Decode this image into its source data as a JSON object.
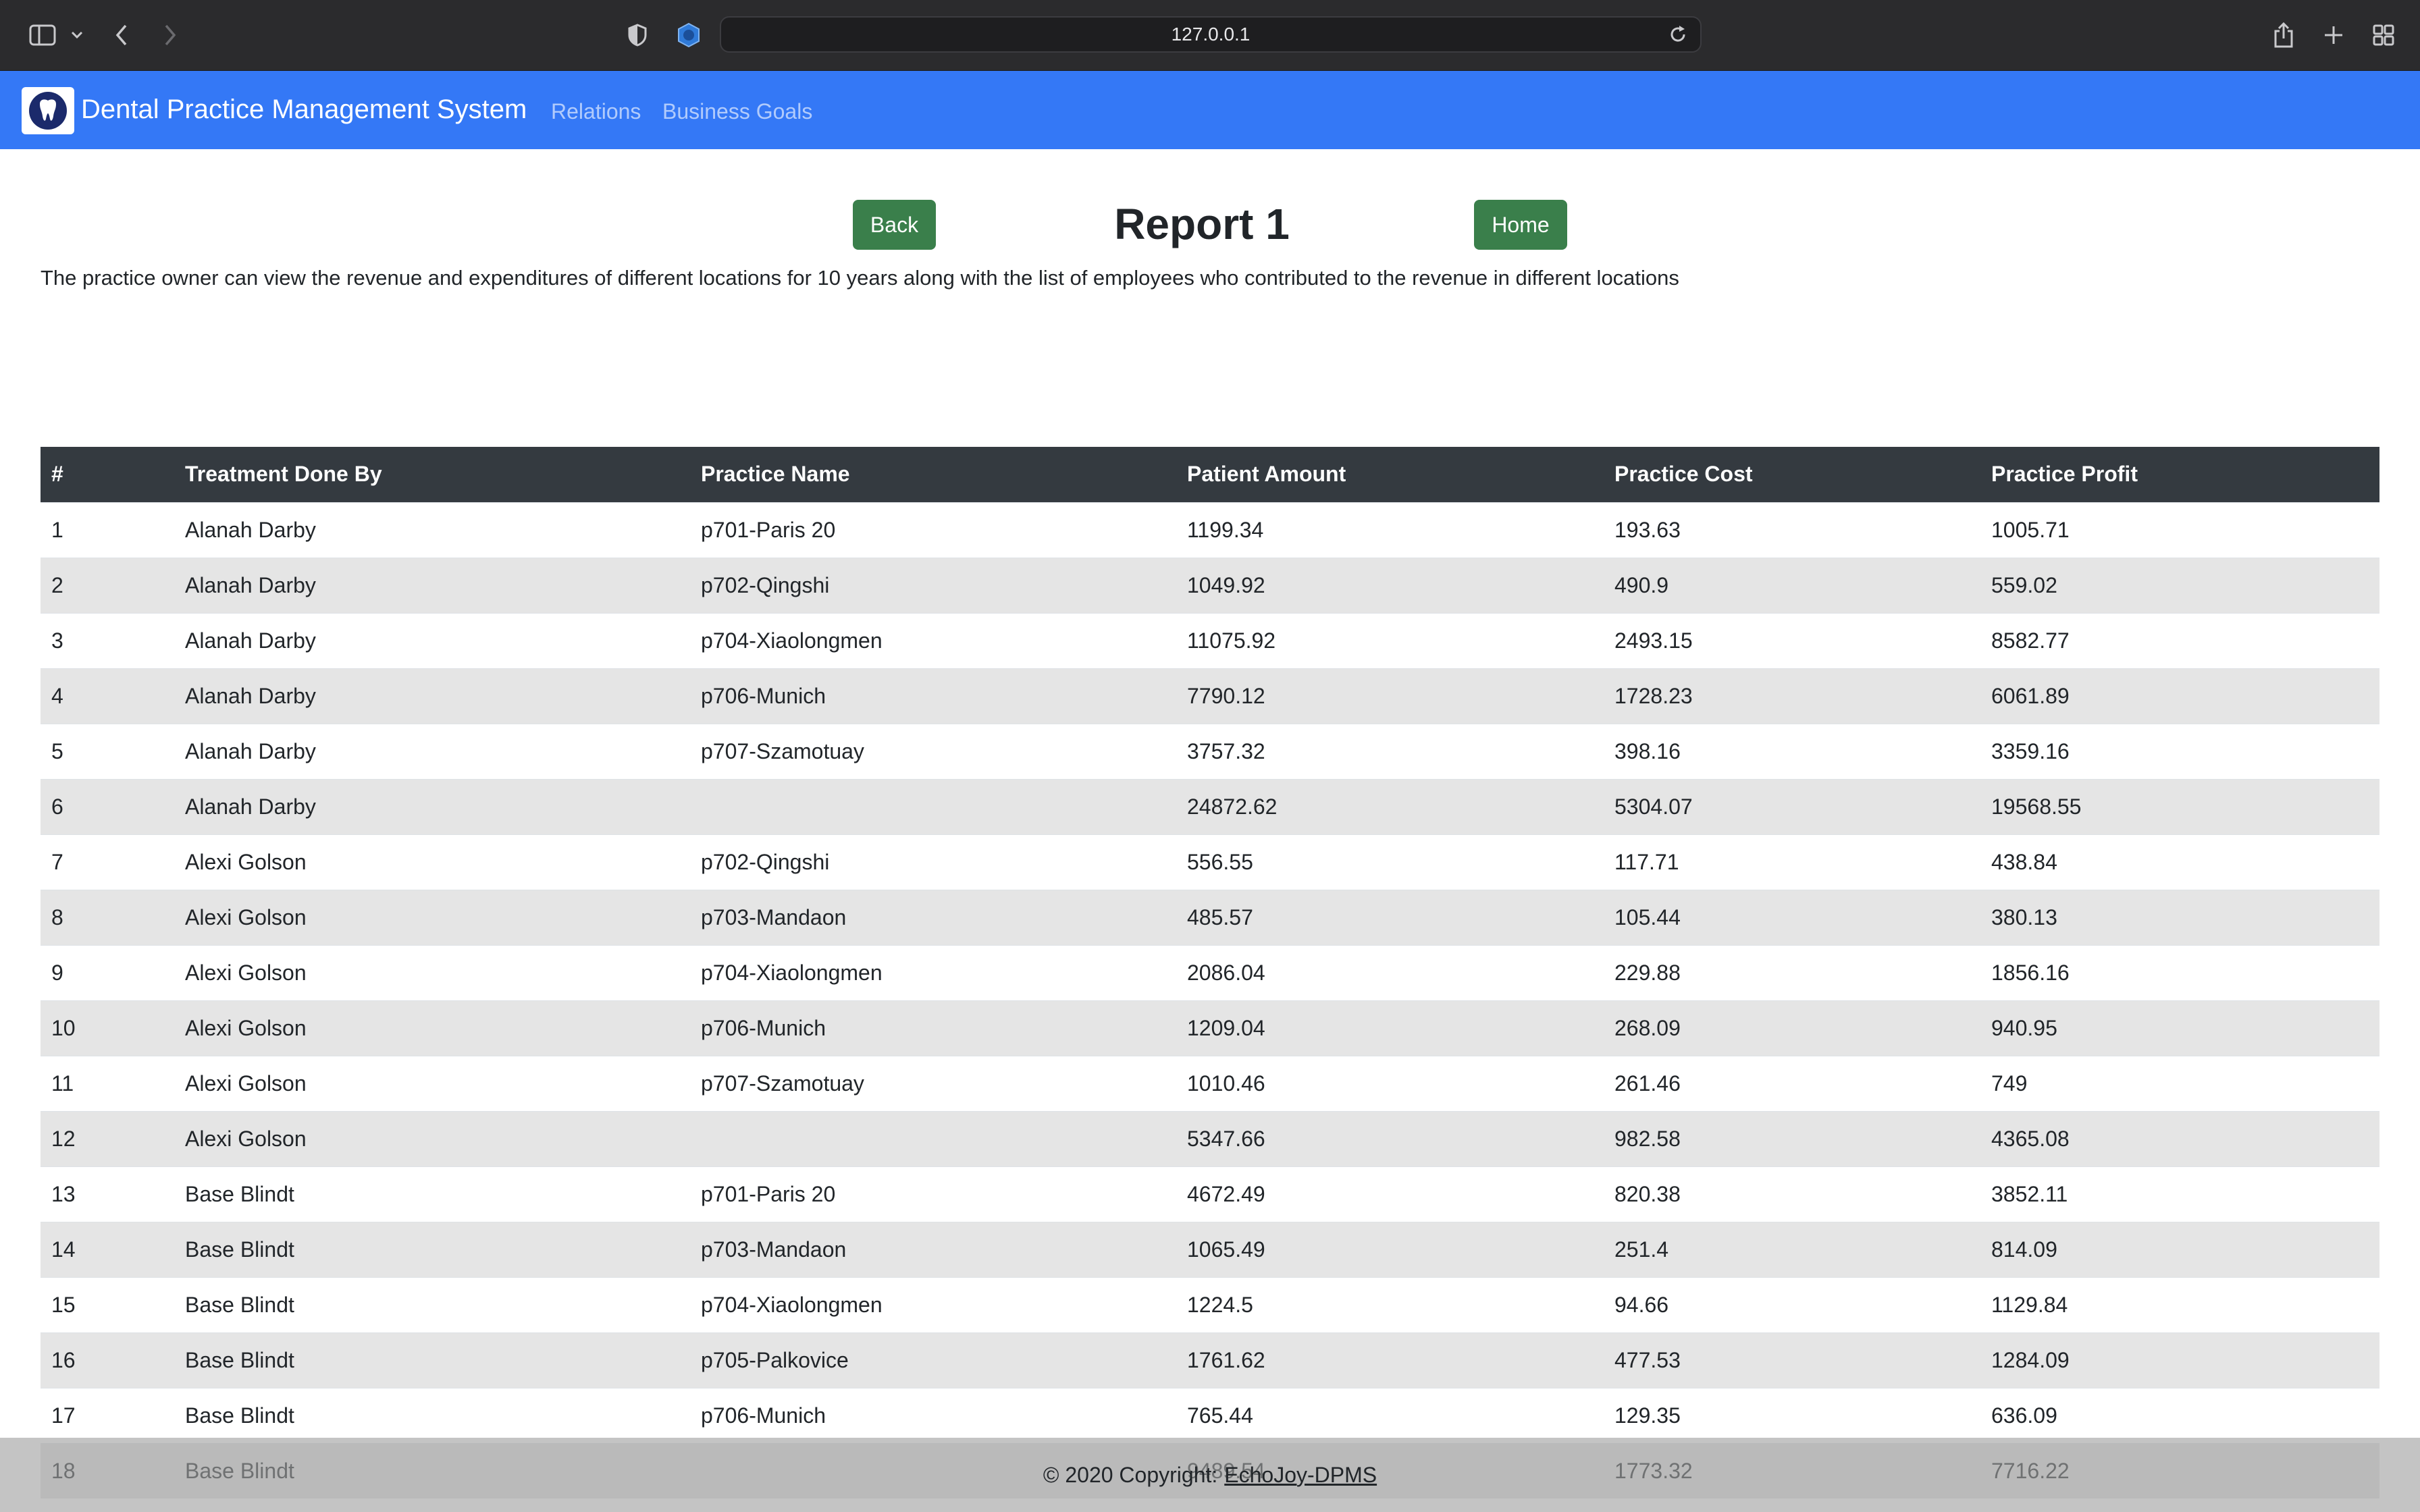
{
  "browser": {
    "url": "127.0.0.1"
  },
  "navbar": {
    "brand": "Dental Practice Management System",
    "links": [
      "Relations",
      "Business Goals"
    ],
    "color": "#3478f6"
  },
  "header": {
    "back_label": "Back",
    "title": "Report 1",
    "home_label": "Home",
    "description": "The practice owner can view the revenue and expenditures of different locations for 10 years along with the list of employees who contributed to the revenue in different locations"
  },
  "table": {
    "columns": [
      "#",
      "Treatment Done By",
      "Practice Name",
      "Patient Amount",
      "Practice Cost",
      "Practice Profit"
    ],
    "rows": [
      [
        "1",
        "Alanah Darby",
        "p701-Paris 20",
        "1199.34",
        "193.63",
        "1005.71"
      ],
      [
        "2",
        "Alanah Darby",
        "p702-Qingshi",
        "1049.92",
        "490.9",
        "559.02"
      ],
      [
        "3",
        "Alanah Darby",
        "p704-Xiaolongmen",
        "11075.92",
        "2493.15",
        "8582.77"
      ],
      [
        "4",
        "Alanah Darby",
        "p706-Munich",
        "7790.12",
        "1728.23",
        "6061.89"
      ],
      [
        "5",
        "Alanah Darby",
        "p707-Szamotuay",
        "3757.32",
        "398.16",
        "3359.16"
      ],
      [
        "6",
        "Alanah Darby",
        "",
        "24872.62",
        "5304.07",
        "19568.55"
      ],
      [
        "7",
        "Alexi Golson",
        "p702-Qingshi",
        "556.55",
        "117.71",
        "438.84"
      ],
      [
        "8",
        "Alexi Golson",
        "p703-Mandaon",
        "485.57",
        "105.44",
        "380.13"
      ],
      [
        "9",
        "Alexi Golson",
        "p704-Xiaolongmen",
        "2086.04",
        "229.88",
        "1856.16"
      ],
      [
        "10",
        "Alexi Golson",
        "p706-Munich",
        "1209.04",
        "268.09",
        "940.95"
      ],
      [
        "11",
        "Alexi Golson",
        "p707-Szamotuay",
        "1010.46",
        "261.46",
        "749"
      ],
      [
        "12",
        "Alexi Golson",
        "",
        "5347.66",
        "982.58",
        "4365.08"
      ],
      [
        "13",
        "Base Blindt",
        "p701-Paris 20",
        "4672.49",
        "820.38",
        "3852.11"
      ],
      [
        "14",
        "Base Blindt",
        "p703-Mandaon",
        "1065.49",
        "251.4",
        "814.09"
      ],
      [
        "15",
        "Base Blindt",
        "p704-Xiaolongmen",
        "1224.5",
        "94.66",
        "1129.84"
      ],
      [
        "16",
        "Base Blindt",
        "p705-Palkovice",
        "1761.62",
        "477.53",
        "1284.09"
      ],
      [
        "17",
        "Base Blindt",
        "p706-Munich",
        "765.44",
        "129.35",
        "636.09"
      ],
      [
        "18",
        "Base Blindt",
        "",
        "9489.54",
        "1773.32",
        "7716.22"
      ]
    ]
  },
  "footer": {
    "copyright": "© 2020 Copyright:",
    "link_label": "EchoJoy-DPMS"
  }
}
